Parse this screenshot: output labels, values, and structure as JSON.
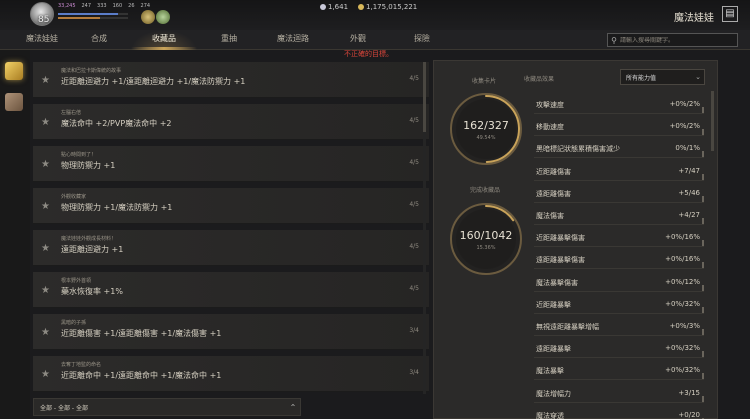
{
  "header": {
    "level": "85",
    "stats": [
      "33,245",
      "247",
      "333",
      "160",
      "26",
      "274"
    ],
    "currency": [
      "1,641",
      "1,175,015,221"
    ],
    "title": "魔法娃娃",
    "icon_name": "book-icon"
  },
  "nav": {
    "tabs": [
      "魔法娃娃",
      "合成",
      "收藏品",
      "重抽",
      "魔法迴路",
      "外觀",
      "探險"
    ],
    "active_tab": "收藏品",
    "search_placeholder": "請輸入搜尋關鍵字。",
    "warning": "不正確的目標。"
  },
  "sidebar": {
    "icons": [
      "card-collection-icon",
      "book-collection-icon"
    ]
  },
  "collection": {
    "items": [
      {
        "title": "魔法和巴拉卡斯偉統的故事",
        "desc": "近距離迴避力 +1/遠距離迴避力 +1/魔法防禦力 +1",
        "count": "4/5"
      },
      {
        "title": "左腦右倍",
        "desc": "魔法命中 +2/PVP魔法命中 +2",
        "count": "4/5"
      },
      {
        "title": "點心時間到了！",
        "desc": "物理防禦力 +1",
        "count": "4/5"
      },
      {
        "title": "外觀收藏家",
        "desc": "物理防禦力 +1/魔法防禦力 +1",
        "count": "4/5"
      },
      {
        "title": "魔法娃娃外觀成長材料！",
        "desc": "遠距離迴避力 +1",
        "count": "4/5"
      },
      {
        "title": "根本野外首領",
        "desc": "藥水恢復率 +1%",
        "count": "4/5"
      },
      {
        "title": "黑暗的子孫",
        "desc": "近距離傷害 +1/遠距離傷害 +1/魔法傷害 +1",
        "count": "3/4"
      },
      {
        "title": "去奪丁地監的命名",
        "desc": "近距離命中 +1/遠距離命中 +1/魔法命中 +1",
        "count": "3/4"
      }
    ],
    "filter_label": "全部 - 全部 - 全部"
  },
  "summary": {
    "cards_caption": "收集卡片",
    "cards_value": "162/327",
    "cards_pct": "49.54%",
    "cards_fraction": 0.4954,
    "completed_caption": "完成收藏品",
    "completed_value": "160/1042",
    "completed_pct": "15.36%",
    "completed_fraction": 0.1536,
    "stats_header": "收藏品效果",
    "filter_dropdown": "所有能力值"
  },
  "stats": [
    {
      "name": "攻擊速度",
      "value": "+0%/2%"
    },
    {
      "name": "移動速度",
      "value": "+0%/2%"
    },
    {
      "name": "黑暗標記狀態累積傷害減少",
      "value": "0%/1%"
    },
    {
      "name": "近距離傷害",
      "value": "+7/47"
    },
    {
      "name": "遠距離傷害",
      "value": "+5/46"
    },
    {
      "name": "魔法傷害",
      "value": "+4/27"
    },
    {
      "name": "近距離暴擊傷害",
      "value": "+0%/16%"
    },
    {
      "name": "遠距離暴擊傷害",
      "value": "+0%/16%"
    },
    {
      "name": "魔法暴擊傷害",
      "value": "+0%/12%"
    },
    {
      "name": "近距離暴擊",
      "value": "+0%/32%"
    },
    {
      "name": "無視遠距離暴擊增幅",
      "value": "+0%/3%"
    },
    {
      "name": "遠距離暴擊",
      "value": "+0%/32%"
    },
    {
      "name": "魔法暴擊",
      "value": "+0%/32%"
    },
    {
      "name": "魔法增幅力",
      "value": "+3/15"
    },
    {
      "name": "魔法穿透",
      "value": "+0/20"
    }
  ],
  "colors": {
    "accent": "#c9a35a",
    "warning": "#d9463a",
    "background": "#1b1b1d"
  }
}
